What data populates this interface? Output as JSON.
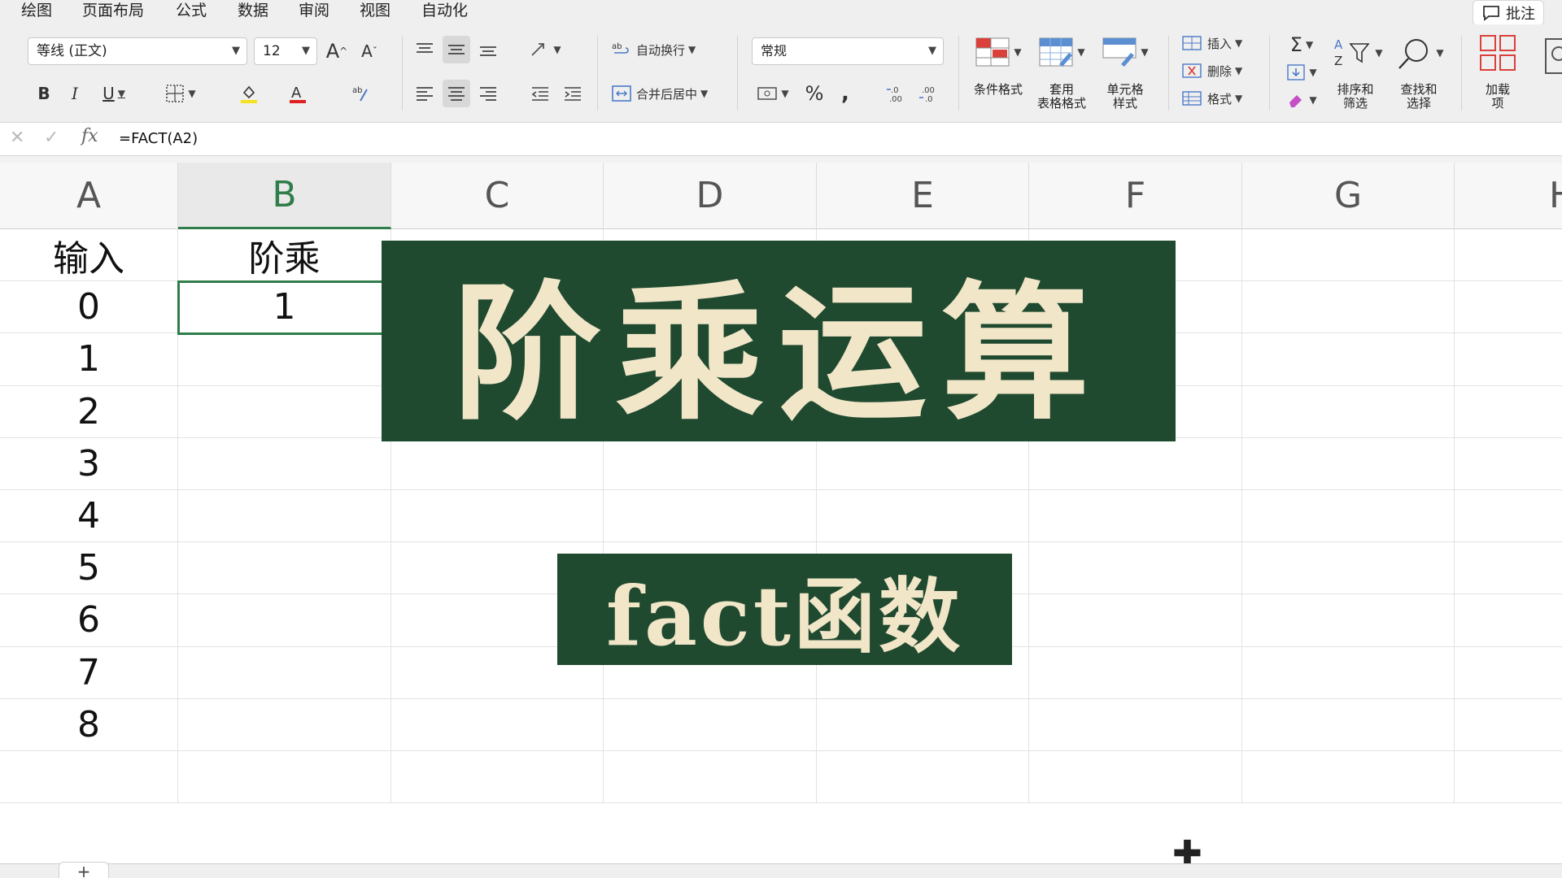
{
  "menu": {
    "items": [
      "绘图",
      "页面布局",
      "公式",
      "数据",
      "审阅",
      "视图",
      "自动化"
    ],
    "comment_label": "批注"
  },
  "ribbon": {
    "font_name": "等线 (正文)",
    "font_size": "12",
    "font_grow": "A",
    "font_shrink": "A",
    "bold": "B",
    "italic": "I",
    "underline": "U",
    "wrap_text": "自动换行",
    "merge_center": "合并后居中",
    "number_format": "常规",
    "percent": "%",
    "comma": ",",
    "conditional_format": "条件格式",
    "table_format_line1": "套用",
    "table_format_line2": "表格格式",
    "cell_style_line1": "单元格",
    "cell_style_line2": "样式",
    "insert": "插入",
    "delete": "删除",
    "format": "格式",
    "sum": "Σ",
    "sort_filter_line1": "排序和",
    "sort_filter_line2": "筛选",
    "find_select_line1": "查找和",
    "find_select_line2": "选择",
    "addins_line1": "加载",
    "addins_line2": "项"
  },
  "formula_bar": {
    "fx": "fx",
    "formula": "=FACT(A2)"
  },
  "sheet": {
    "columns": [
      "A",
      "B",
      "C",
      "D",
      "E",
      "F",
      "G",
      "H"
    ],
    "active_column": "B",
    "header_a": "输入",
    "header_b": "阶乘",
    "a_values": [
      "0",
      "1",
      "2",
      "3",
      "4",
      "5",
      "6",
      "7",
      "8"
    ],
    "b_values": [
      "1"
    ]
  },
  "overlay": {
    "title": "阶乘运算",
    "subtitle": "fact函数"
  },
  "colors": {
    "accent_green": "#2e7d4a",
    "banner_bg": "#1f4a2f",
    "banner_text": "#f2e6c9"
  }
}
